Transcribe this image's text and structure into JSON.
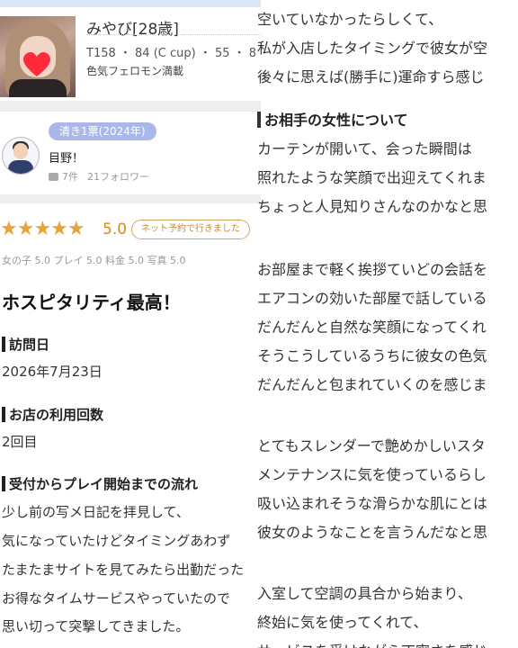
{
  "profile": {
    "name": "みやび[28歳]",
    "stats": "T158 ・ 84 (C cup) ・ 55 ・ 8",
    "tagline": "色気フェロモン満載"
  },
  "reviewer": {
    "badge": "清き1票(2024年)",
    "name": "目野！",
    "posts": "7件",
    "followers": "21フォロワー"
  },
  "rating": {
    "stars": "★★★★★",
    "score": "5.0",
    "net_reservation_label": "ネット予約で行きました",
    "subscores": "女の子 5.0  プレイ 5.0  料金 5.0  写真 5.0"
  },
  "review": {
    "headline": "ホスピタリティ最高！",
    "visit_date_heading": "訪問日",
    "visit_date": "2026年7月23日",
    "usage_count_heading": "お店の利用回数",
    "usage_count": "2回目",
    "flow_heading": "受付からプレイ開始までの流れ",
    "flow_lines": [
      "少し前の写メ日記を拝見して、",
      "気になっていたけどタイミングあわず",
      "たまたまサイトを見てみたら出勤だった",
      "お得なタイムサービスやっていたので",
      "思い切って突撃してきました。"
    ]
  },
  "right_column": {
    "lines_top": [
      "空いていなかったらしくて、",
      "私が入店したタイミングで彼女が空",
      "後々に思えば(勝手に)運命すら感じ"
    ],
    "section_heading": "お相手の女性について",
    "lines_a": [
      "カーテンが開いて、会った瞬間は",
      "照れたような笑顔で出迎えてくれま",
      "ちょっと人見知りさんなのかなと思"
    ],
    "lines_b": [
      "お部屋まで軽く挨拶ていどの会話を",
      "エアコンの効いた部屋で話している",
      "だんだんと自然な笑顔になってくれ",
      "そうこうしているうちに彼女の色気",
      "だんだんと包まれていくのを感じま"
    ],
    "lines_c": [
      "とてもスレンダーで艶めかしいスタ",
      "メンテナンスに気を使っているらし",
      "吸い込まれそうな滑らかな肌にとは",
      "彼女のようなことを言うんだなと思"
    ],
    "lines_d": [
      "入室して空調の具合から始まり、",
      "終始に気を使ってくれて、",
      "サービスを受けながら丁寧さを感じ"
    ]
  }
}
